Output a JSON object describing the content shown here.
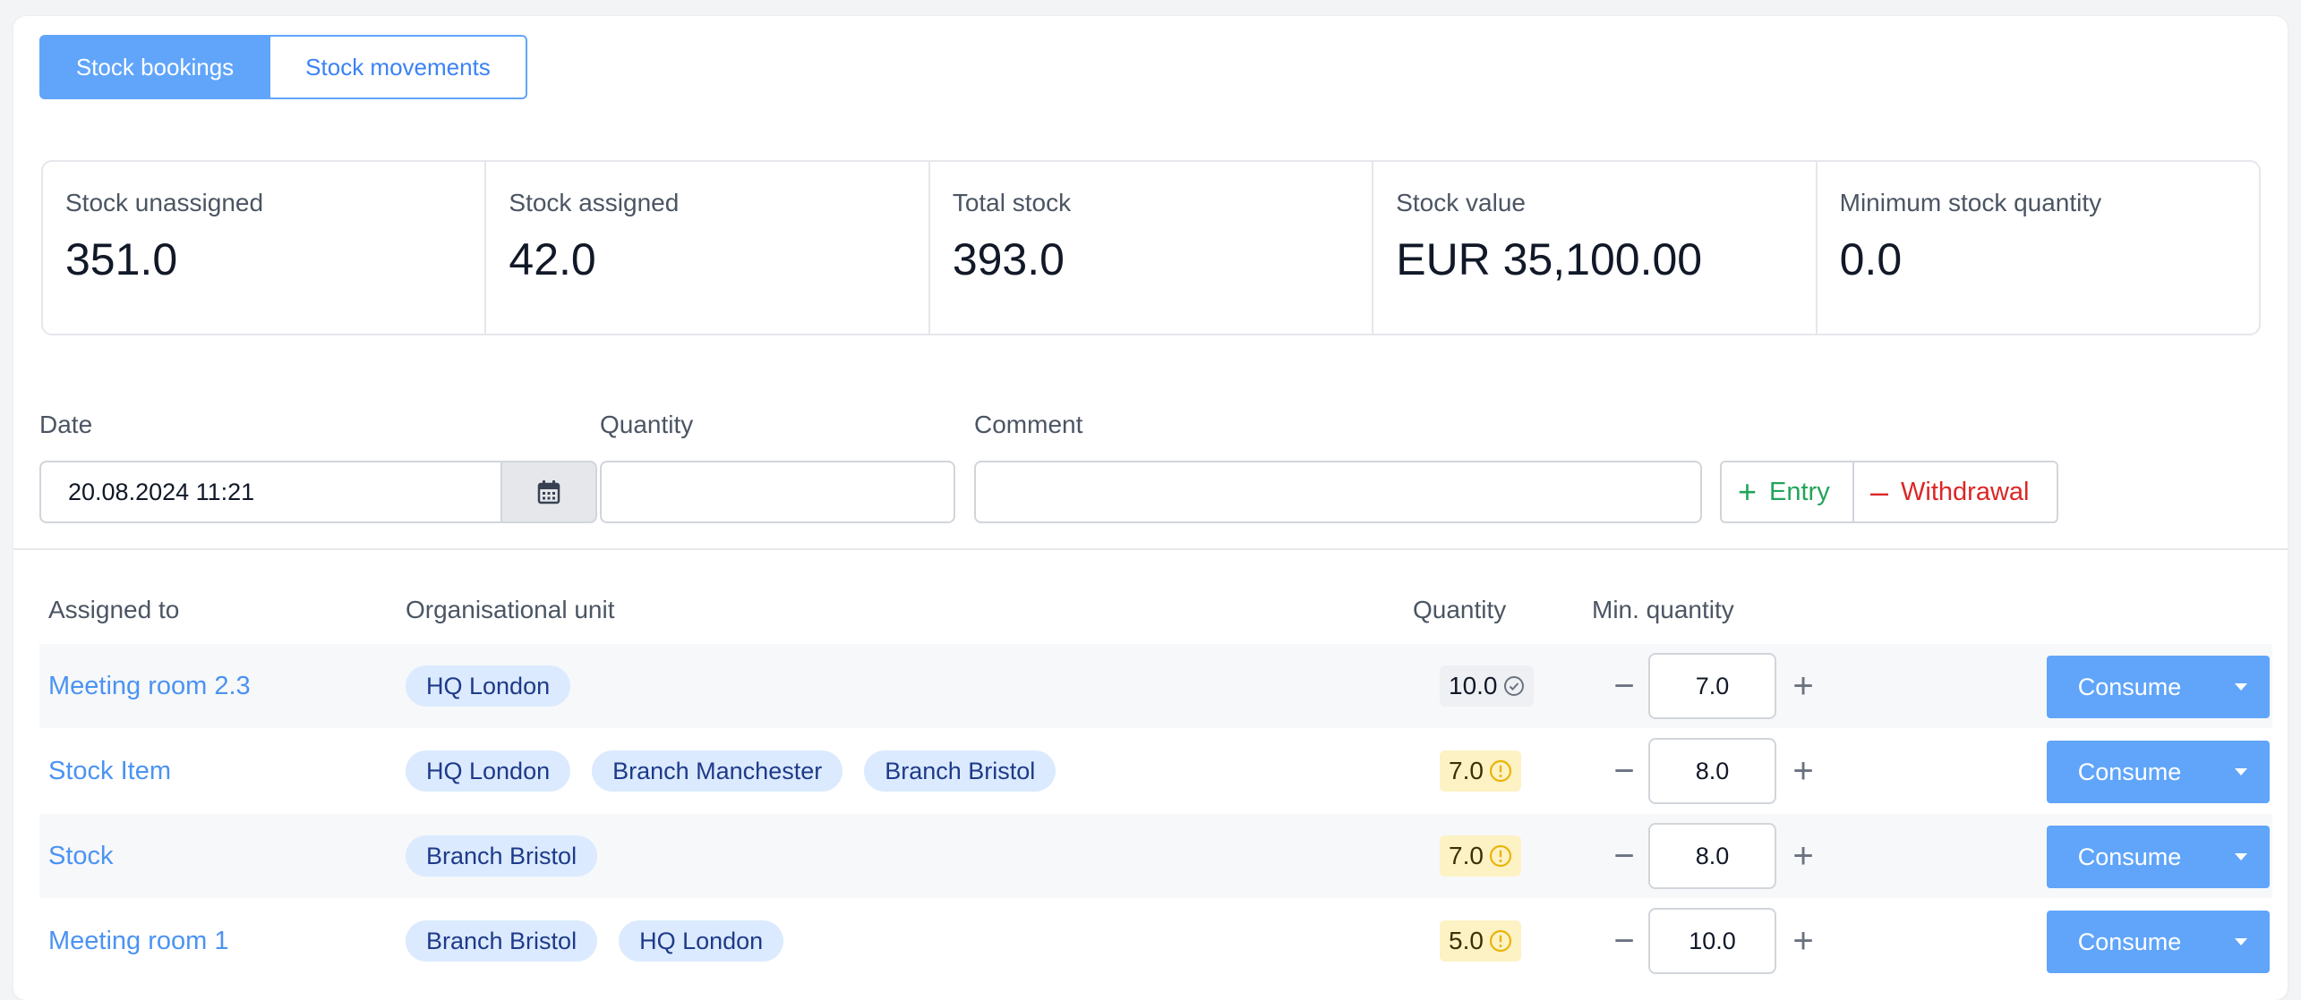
{
  "tabs": [
    {
      "label": "Stock bookings",
      "active": true
    },
    {
      "label": "Stock movements",
      "active": false
    }
  ],
  "stats": [
    {
      "label": "Stock unassigned",
      "value": "351.0"
    },
    {
      "label": "Stock assigned",
      "value": "42.0"
    },
    {
      "label": "Total stock",
      "value": "393.0"
    },
    {
      "label": "Stock value",
      "value": "EUR 35,100.00"
    },
    {
      "label": "Minimum stock quantity",
      "value": "0.0"
    }
  ],
  "form": {
    "date_label": "Date",
    "date_value": "20.08.2024 11:21",
    "quantity_label": "Quantity",
    "quantity_value": "",
    "comment_label": "Comment",
    "comment_value": "",
    "entry_label": "Entry",
    "withdrawal_label": "Withdrawal"
  },
  "table": {
    "headers": {
      "assigned_to": "Assigned to",
      "org_unit": "Organisational unit",
      "quantity": "Quantity",
      "min_quantity": "Min. quantity"
    },
    "rows": [
      {
        "assigned_to": "Meeting room 2.3",
        "units": [
          "HQ London"
        ],
        "quantity": "10.0",
        "status": "ok",
        "min_quantity": "7.0",
        "action": "Consume"
      },
      {
        "assigned_to": "Stock Item",
        "units": [
          "HQ London",
          "Branch Manchester",
          "Branch Bristol"
        ],
        "quantity": "7.0",
        "status": "warning",
        "min_quantity": "8.0",
        "action": "Consume"
      },
      {
        "assigned_to": "Stock",
        "units": [
          "Branch Bristol"
        ],
        "quantity": "7.0",
        "status": "warning",
        "min_quantity": "8.0",
        "action": "Consume"
      },
      {
        "assigned_to": "Meeting room 1",
        "units": [
          "Branch Bristol",
          "HQ London"
        ],
        "quantity": "5.0",
        "status": "warning",
        "min_quantity": "10.0",
        "action": "Consume"
      }
    ]
  },
  "colors": {
    "primary": "#60a5fa",
    "link": "#4b93f2",
    "chip_bg": "#dbeafe",
    "chip_text": "#1e3a8a",
    "entry": "#22a55a",
    "withdrawal": "#dc2626",
    "warning_bg": "#fdf2c4",
    "warning_icon": "#eab308"
  },
  "icons": {
    "calendar": "calendar-icon",
    "ok": "check-circle-icon",
    "warning": "warning-circle-icon",
    "caret": "caret-down-icon"
  }
}
